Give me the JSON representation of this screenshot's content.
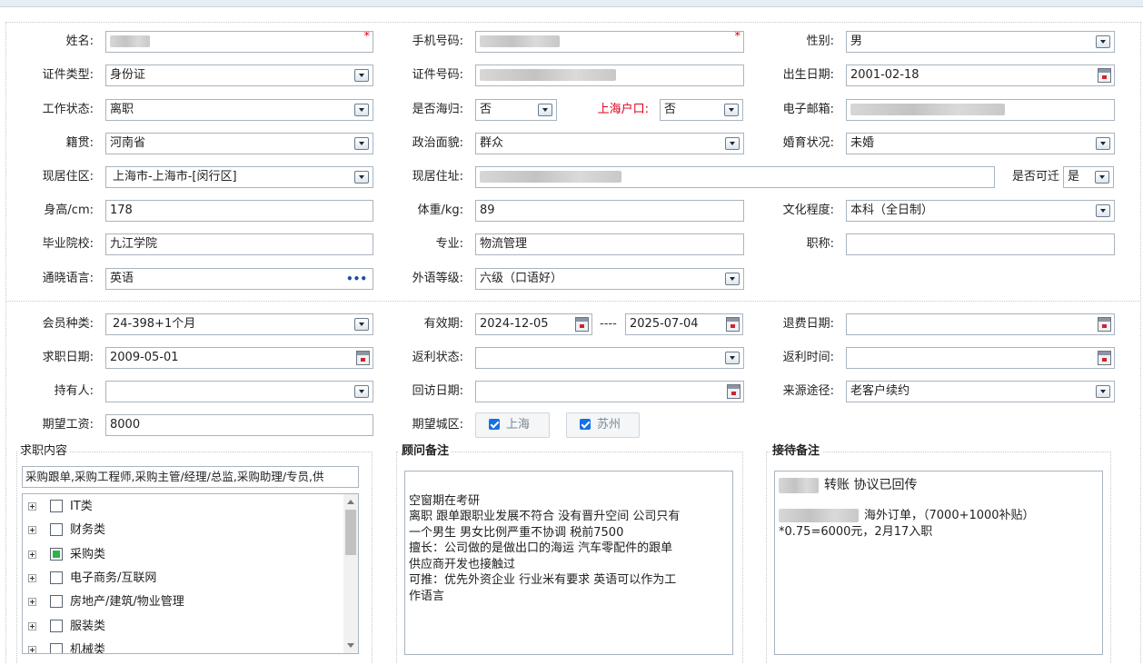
{
  "basic": {
    "name_label": "姓名:",
    "phone_label": "手机号码:",
    "gender_label": "性别:",
    "gender_value": "男",
    "idtype_label": "证件类型:",
    "idtype_value": "身份证",
    "idno_label": "证件号码:",
    "birth_label": "出生日期:",
    "birth_value": "2001-02-18",
    "workstatus_label": "工作状态:",
    "workstatus_value": "离职",
    "returnee_label": "是否海归:",
    "returnee_value": "否",
    "shhukou_label": "上海户口:",
    "shhukou_value": "否",
    "email_label": "电子邮箱:",
    "native_label": "籍贯:",
    "native_value": "河南省",
    "political_label": "政治面貌:",
    "political_value": "群众",
    "marital_label": "婚育状况:",
    "marital_value": "未婚",
    "district_label": "现居住区:",
    "district_value": "上海市-上海市-[闵行区]",
    "address_label": "现居住址:",
    "relocate_label": "是否可迁",
    "relocate_value": "是",
    "height_label": "身高/cm:",
    "height_value": "178",
    "weight_label": "体重/kg:",
    "weight_value": "89",
    "education_label": "文化程度:",
    "education_value": "本科（全日制）",
    "school_label": "毕业院校:",
    "school_value": "九江学院",
    "major_label": "专业:",
    "major_value": "物流管理",
    "title_label": "职称:",
    "title_value": "",
    "language_label": "通晓语言:",
    "language_value": "英语",
    "more_glyph": "•••",
    "langlevel_label": "外语等级:",
    "langlevel_value": "六级（口语好）"
  },
  "member": {
    "type_label": "会员种类:",
    "type_value": "24-398+1个月",
    "valid_label": "有效期:",
    "valid_from": "2024-12-05",
    "valid_sep": "----",
    "valid_to": "2025-07-04",
    "refund_label": "退费日期:",
    "refund_value": "",
    "jobdate_label": "求职日期:",
    "jobdate_value": "2009-05-01",
    "rebate_status_label": "返利状态:",
    "rebate_status_value": "",
    "rebate_time_label": "返利时间:",
    "rebate_time_value": "",
    "holder_label": "持有人:",
    "holder_value": "",
    "visit_label": "回访日期:",
    "visit_value": "",
    "source_label": "来源途径:",
    "source_value": "老客户续约",
    "salary_label": "期望工资:",
    "salary_value": "8000",
    "city_label": "期望城区:",
    "city_options": [
      "上海",
      "苏州"
    ]
  },
  "job_content": {
    "title": "求职内容",
    "summary": "采购跟单,采购工程师,采购主管/经理/总监,采购助理/专员,供",
    "tree": [
      {
        "label": "IT类",
        "checked": false
      },
      {
        "label": "财务类",
        "checked": false
      },
      {
        "label": "采购类",
        "checked": true
      },
      {
        "label": "电子商务/互联网",
        "checked": false
      },
      {
        "label": "房地产/建筑/物业管理",
        "checked": false
      },
      {
        "label": "服装类",
        "checked": false
      },
      {
        "label": "机械类",
        "checked": false
      }
    ]
  },
  "consultant_notes": {
    "title": "顾问备注",
    "lines": [
      "",
      "空窗期在考研",
      "离职 跟单跟职业发展不符合 没有晋升空间    公司只有",
      "一个男生  男女比例严重不协调 税前7500",
      "擅长：公司做的是做出口的海运      汽车零配件的跟单",
      "供应商开发也接触过",
      "可推：优先外资企业  行业米有要求    英语可以作为工",
      "作语言"
    ]
  },
  "reception_notes": {
    "title": "接待备注",
    "line1": "转账 协议已回传",
    "line2": "海外订单，（7000+1000补贴）",
    "line3": "*0.75=6000元，2月17入职"
  }
}
